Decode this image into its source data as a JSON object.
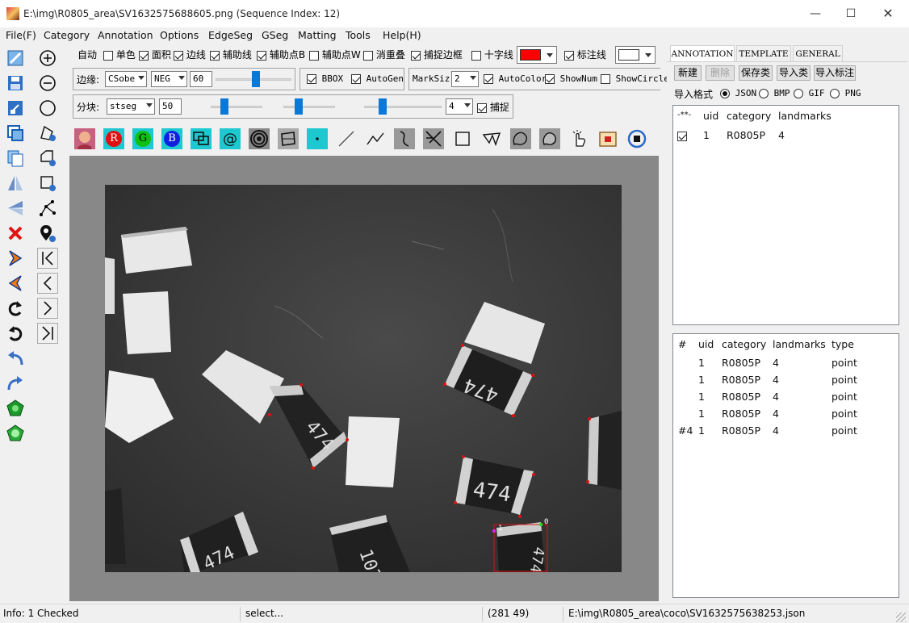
{
  "window": {
    "title": "E:\\img\\R0805_area\\SV1632575688605.png (Sequence Index: 12)"
  },
  "menu": [
    "File(F)",
    "Category",
    "Annotation",
    "Options",
    "EdgeSeg",
    "GSeg",
    "Matting",
    "Tools",
    "Help(H)"
  ],
  "toolbar1": {
    "auto": "自动",
    "single_color": "单色",
    "area": "面积",
    "edge_line": "边线",
    "aux_line": "辅助线",
    "aux_point_b": "辅助点B",
    "aux_point_w": "辅助点W",
    "remove_overlap": "消重叠",
    "capture_border": "捕捉边框",
    "crosshair": "十字线",
    "label_line": "标注线",
    "line_color": "#ff0000",
    "fill_color": "#ffffff"
  },
  "toolbar2": {
    "edge_label": "边缘:",
    "edge_method": "CSobe",
    "edge_mode": "NEG",
    "edge_value": "60",
    "bbox": "BBOX",
    "autogen": "AutoGen",
    "marksize_label": "MarkSiz",
    "marksize": "2",
    "autocolor": "AutoColor",
    "shownum": "ShowNum",
    "showcircle": "ShowCircle"
  },
  "toolbar3": {
    "block_label": "分块:",
    "block_method": "stseg",
    "block_value": "50",
    "count": "4",
    "capture": "捕捉"
  },
  "toolbar4": {
    "r": "R",
    "g": "G",
    "b": "B"
  },
  "image_labels": {
    "p1": "1",
    "p0": "0"
  },
  "right_panel": {
    "tabs": [
      "ANNOTATION",
      "TEMPLATE",
      "GENERAL"
    ],
    "buttons": [
      "新建",
      "删除",
      "保存类",
      "导入类",
      "导入标注"
    ],
    "import_format_label": "导入格式",
    "formats": [
      "JSON",
      "BMP",
      "GIF",
      "PNG"
    ],
    "class_table": {
      "headers": [
        "-**-",
        "uid",
        "category",
        "landmarks"
      ],
      "rows": [
        {
          "uid": "1",
          "category": "R0805P",
          "landmarks": "4"
        }
      ]
    },
    "annot_table": {
      "headers": [
        "#",
        "uid",
        "category",
        "landmarks",
        "type"
      ],
      "rows": [
        {
          "idx": "",
          "uid": "1",
          "category": "R0805P",
          "landmarks": "4",
          "type": "point"
        },
        {
          "idx": "",
          "uid": "1",
          "category": "R0805P",
          "landmarks": "4",
          "type": "point"
        },
        {
          "idx": "",
          "uid": "1",
          "category": "R0805P",
          "landmarks": "4",
          "type": "point"
        },
        {
          "idx": "",
          "uid": "1",
          "category": "R0805P",
          "landmarks": "4",
          "type": "point"
        },
        {
          "idx": "#4",
          "uid": "1",
          "category": "R0805P",
          "landmarks": "4",
          "type": "point"
        }
      ]
    }
  },
  "status": {
    "info": "Info: 1 Checked",
    "mode": "select...",
    "coords": "(281  49)",
    "file": "E:\\img\\R0805_area\\coco\\SV1632575638253.json"
  }
}
